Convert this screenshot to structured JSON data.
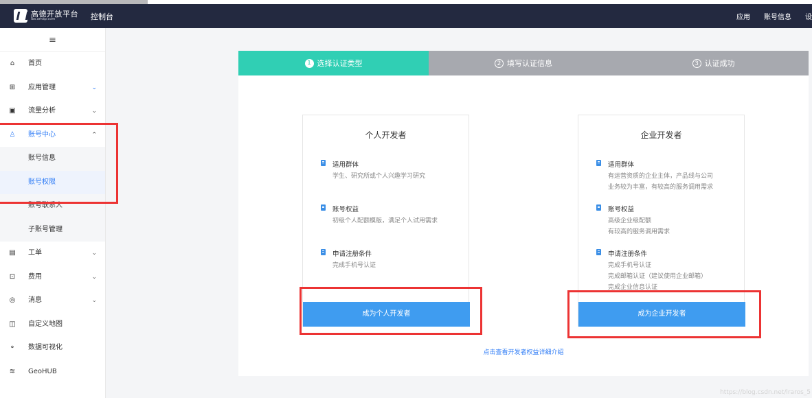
{
  "header": {
    "logo_text": "高德开放平台",
    "logo_sub": "lbs.amap.com",
    "console_label": "控制台",
    "nav": [
      "应用",
      "账号信息",
      "设"
    ]
  },
  "sidebar": {
    "menu_icon": "≡",
    "items": [
      {
        "label": "首页",
        "icon": "home-icon"
      },
      {
        "label": "应用管理",
        "icon": "grid-icon"
      },
      {
        "label": "流量分析",
        "icon": "chart-icon"
      },
      {
        "label": "账号中心",
        "icon": "user-icon"
      },
      {
        "label": "账号信息"
      },
      {
        "label": "账号权限"
      },
      {
        "label": "账号联系人"
      },
      {
        "label": "子账号管理"
      },
      {
        "label": "工单",
        "icon": "ticket-icon"
      },
      {
        "label": "费用",
        "icon": "fee-icon"
      },
      {
        "label": "消息",
        "icon": "message-icon"
      },
      {
        "label": "自定义地图",
        "icon": "map-icon"
      },
      {
        "label": "数据可视化",
        "icon": "visual-icon"
      },
      {
        "label": "GeoHUB",
        "icon": "layers-icon"
      }
    ]
  },
  "steps": [
    {
      "num": "1",
      "label": "选择认证类型"
    },
    {
      "num": "2",
      "label": "填写认证信息"
    },
    {
      "num": "3",
      "label": "认证成功"
    }
  ],
  "personal": {
    "title": "个人开发者",
    "f1_title": "适用群体",
    "f1_desc1": "学生、研究所或个人兴趣学习研究",
    "f2_title": "账号权益",
    "f2_desc1": "初级个人配额模版，满足个人试用需求",
    "f3_title": "申请注册条件",
    "f3_desc1": "完成手机号认证",
    "button": "成为个人开发者"
  },
  "enterprise": {
    "title": "企业开发者",
    "f1_title": "适用群体",
    "f1_desc1": "有运营资质的企业主体，产品线与公司",
    "f1_desc2": "业务较为丰富，有较高的服务调用需求",
    "f2_title": "账号权益",
    "f2_desc1": "高级企业级配额",
    "f2_desc2": "有较高的服务调用需求",
    "f3_title": "申请注册条件",
    "f3_desc1": "完成手机号认证",
    "f3_desc2": "完成邮箱认证（建议使用企业邮箱）",
    "f3_desc3": "完成企业信息认证",
    "button": "成为企业开发者"
  },
  "bottom_link": "点击查看开发者权益详细介绍",
  "watermark": "https://blog.csdn.net/lraros_5"
}
